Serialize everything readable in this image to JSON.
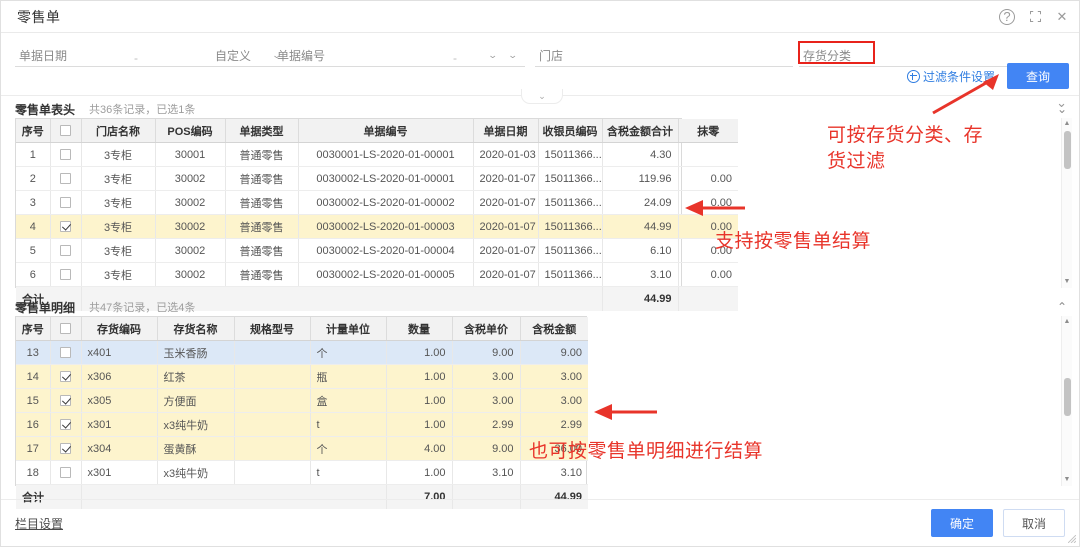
{
  "window": {
    "title": "零售单",
    "controls": [
      {
        "name": "help-icon",
        "glyph": "?"
      },
      {
        "name": "maximize-icon",
        "glyph": "⛶"
      },
      {
        "name": "close-icon",
        "glyph": "✕"
      }
    ]
  },
  "filters": {
    "date_label": "单据日期",
    "date_separator": "-",
    "date_mode": "自定义",
    "doc_no_label": "单据编号",
    "doc_no_separator": "-",
    "store_label": "门店",
    "inventory_category_label": "存货分类"
  },
  "toolbar": {
    "filter_settings": "过滤条件设置",
    "query_button": "查询"
  },
  "section_header": {
    "title": "零售单表头",
    "count": "共36条记录，已选1条"
  },
  "section_detail": {
    "title": "零售单明细",
    "count": "共47条记录，已选4条"
  },
  "table_header": {
    "columns": [
      "序号",
      "",
      "门店名称",
      "POS编码",
      "单据类型",
      "单据编号",
      "单据日期",
      "收银员编码",
      "含税金额合计",
      "抹零"
    ],
    "rows": [
      {
        "no": "1",
        "checked": false,
        "selected": false,
        "store": "3专柜",
        "pos": "30001",
        "type": "普通零售",
        "docno": "0030001-LS-2020-01-00001",
        "date": "2020-01-03",
        "cashier": "15011366...",
        "amount": "4.30",
        "round": ""
      },
      {
        "no": "2",
        "checked": false,
        "selected": false,
        "store": "3专柜",
        "pos": "30002",
        "type": "普通零售",
        "docno": "0030002-LS-2020-01-00001",
        "date": "2020-01-07",
        "cashier": "15011366...",
        "amount": "119.96",
        "round": "0.00"
      },
      {
        "no": "3",
        "checked": false,
        "selected": false,
        "store": "3专柜",
        "pos": "30002",
        "type": "普通零售",
        "docno": "0030002-LS-2020-01-00002",
        "date": "2020-01-07",
        "cashier": "15011366...",
        "amount": "24.09",
        "round": "0.00"
      },
      {
        "no": "4",
        "checked": true,
        "selected": true,
        "store": "3专柜",
        "pos": "30002",
        "type": "普通零售",
        "docno": "0030002-LS-2020-01-00003",
        "date": "2020-01-07",
        "cashier": "15011366...",
        "amount": "44.99",
        "round": "0.00"
      },
      {
        "no": "5",
        "checked": false,
        "selected": false,
        "store": "3专柜",
        "pos": "30002",
        "type": "普通零售",
        "docno": "0030002-LS-2020-01-00004",
        "date": "2020-01-07",
        "cashier": "15011366...",
        "amount": "6.10",
        "round": "0.00"
      },
      {
        "no": "6",
        "checked": false,
        "selected": false,
        "store": "3专柜",
        "pos": "30002",
        "type": "普通零售",
        "docno": "0030002-LS-2020-01-00005",
        "date": "2020-01-07",
        "cashier": "15011366...",
        "amount": "3.10",
        "round": "0.00"
      }
    ],
    "total_label": "合计",
    "total_amount": "44.99"
  },
  "table_detail": {
    "columns": [
      "序号",
      "",
      "存货编码",
      "存货名称",
      "规格型号",
      "计量单位",
      "数量",
      "含税单价",
      "含税金额"
    ],
    "rows": [
      {
        "no": "13",
        "checked": false,
        "state": "cur",
        "code": "x401",
        "name": "玉米香肠",
        "spec": "",
        "unit": "个",
        "qty": "1.00",
        "price": "9.00",
        "amount": "9.00"
      },
      {
        "no": "14",
        "checked": true,
        "state": "sel",
        "code": "x306",
        "name": "红茶",
        "spec": "",
        "unit": "瓶",
        "qty": "1.00",
        "price": "3.00",
        "amount": "3.00"
      },
      {
        "no": "15",
        "checked": true,
        "state": "sel",
        "code": "x305",
        "name": "方便面",
        "spec": "",
        "unit": "盒",
        "qty": "1.00",
        "price": "3.00",
        "amount": "3.00"
      },
      {
        "no": "16",
        "checked": true,
        "state": "sel",
        "code": "x301",
        "name": "x3纯牛奶",
        "spec": "",
        "unit": "t",
        "qty": "1.00",
        "price": "2.99",
        "amount": "2.99"
      },
      {
        "no": "17",
        "checked": true,
        "state": "sel",
        "code": "x304",
        "name": "蛋黄酥",
        "spec": "",
        "unit": "个",
        "qty": "4.00",
        "price": "9.00",
        "amount": "36.00"
      },
      {
        "no": "18",
        "checked": false,
        "state": "",
        "code": "x301",
        "name": "x3纯牛奶",
        "spec": "",
        "unit": "t",
        "qty": "1.00",
        "price": "3.10",
        "amount": "3.10"
      }
    ],
    "total_label": "合计",
    "total_qty": "7.00",
    "total_amount": "44.99"
  },
  "annotations": {
    "a1": "可按存货分类、存\n货过滤",
    "a2": "支持按零售单结算",
    "a3": "也可按零售单明细进行结算"
  },
  "footer": {
    "column_settings": "栏目设置",
    "ok": "确定",
    "cancel": "取消"
  },
  "colors": {
    "accent": "#4285f4",
    "annotation": "#e8342a",
    "selected_row": "#fdf4cd",
    "current_row": "#dce8f7"
  }
}
